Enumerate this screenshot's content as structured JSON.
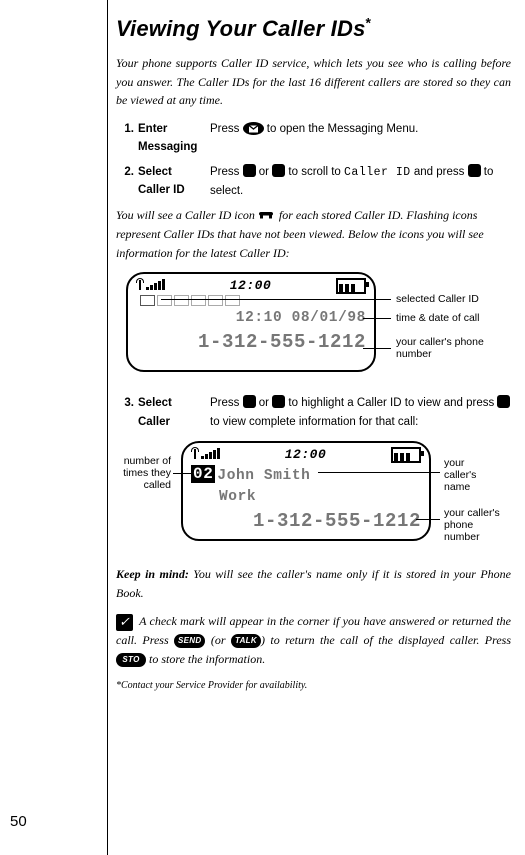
{
  "page_number": "50",
  "title_main": "Viewing Your Caller IDs",
  "title_sup": "*",
  "intro": "Your phone supports Caller ID service, which lets you see who is calling before you answer. The Caller IDs for the last 16 different callers are stored so they can be viewed at any time.",
  "steps": {
    "s1": {
      "num": "1.",
      "name_l1": "Enter",
      "name_l2": "Messaging",
      "text_before": "Press ",
      "text_after": " to open the Messaging Menu."
    },
    "s2": {
      "num": "2.",
      "name_l1": "Select",
      "name_l2": "Caller ID",
      "text_a": "Press ",
      "text_b": " or ",
      "text_c": " to scroll to ",
      "lcd_word": "Caller ID",
      "text_d": " and press ",
      "text_e": " to select."
    },
    "s3": {
      "num": "3.",
      "name_l1": "Select",
      "name_l2": "Caller",
      "text_a": "Press ",
      "text_b": " or ",
      "text_c": " to highlight a Caller ID to view and press ",
      "text_d": " to view complete information for that call:"
    }
  },
  "mid_text_a": "You will see a Caller ID icon",
  "mid_text_b": " for each stored Caller ID. Flashing icons represent Caller IDs that have not been viewed. Below the icons you will see information for the latest Caller ID:",
  "lcd1": {
    "clock": "12:00",
    "datetime": "12:10 08/01/98",
    "number": "1-312-555-1212",
    "annot_selected": "selected Caller ID",
    "annot_time": "time & date of call",
    "annot_number": "your caller's phone number"
  },
  "lcd2": {
    "clock": "12:00",
    "count": "02",
    "name": "John Smith",
    "label": "Work",
    "number": "1-312-555-1212",
    "annot_count": "number of times they called",
    "annot_name": "your caller's name",
    "annot_number": "your caller's phone number"
  },
  "keep_in_mind_label": "Keep in mind:",
  "keep_in_mind_text": " You will see the caller's name only if it is stored in your Phone Book.",
  "check_text_a": " A check mark will appear in the corner if you have answered or returned the call. Press ",
  "key_send": "SEND",
  "check_text_b": " (or ",
  "key_talk": "TALK",
  "check_text_c": ") to return the call of the displayed caller. Press ",
  "key_sto": "STO",
  "check_text_d": " to store the information.",
  "footnote": "*Contact your Service Provider for availability."
}
